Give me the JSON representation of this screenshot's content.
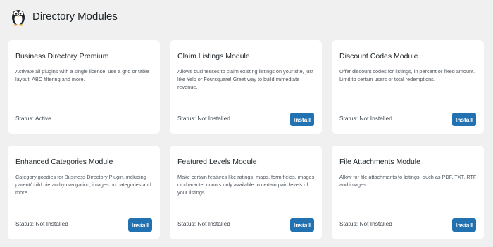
{
  "header": {
    "title": "Directory Modules",
    "logo_icon": "penguin-logo-icon"
  },
  "colors": {
    "accent": "#2271b1",
    "background": "#f0f0f1",
    "card": "#ffffff"
  },
  "modules": [
    {
      "title": "Business Directory Premium",
      "description": "Activate all plugins with a single license, use a grid or table layout, ABC filtering and more.",
      "status": "Status: Active",
      "button": ""
    },
    {
      "title": "Claim Listings Module",
      "description": "Allows businesses to claim existing listings on your site, just like Yelp or Foursquare! Great way to build immediate revenue.",
      "status": "Status: Not Installed",
      "button": "Install"
    },
    {
      "title": "Discount Codes Module",
      "description": "Offer discount codes for listings, in percent or fixed amount. Limit to certain users or total redemptions.",
      "status": "Status: Not Installed",
      "button": "Install"
    },
    {
      "title": "Enhanced Categories Module",
      "description": "Category goodies for Business Directory Plugin, including parent/child hierarchy navigation, images on categories and more.",
      "status": "Status: Not Installed",
      "button": "Install"
    },
    {
      "title": "Featured Levels Module",
      "description": "Make certain features like ratings, maps, form fields, images or character counts only available to certain paid levels of your listings.",
      "status": "Status: Not Installed",
      "button": "Install"
    },
    {
      "title": "File Attachments Module",
      "description": "Allow for file attachments to listings--such as PDF, TXT, RTF and images",
      "status": "Status: Not Installed",
      "button": "Install"
    }
  ]
}
